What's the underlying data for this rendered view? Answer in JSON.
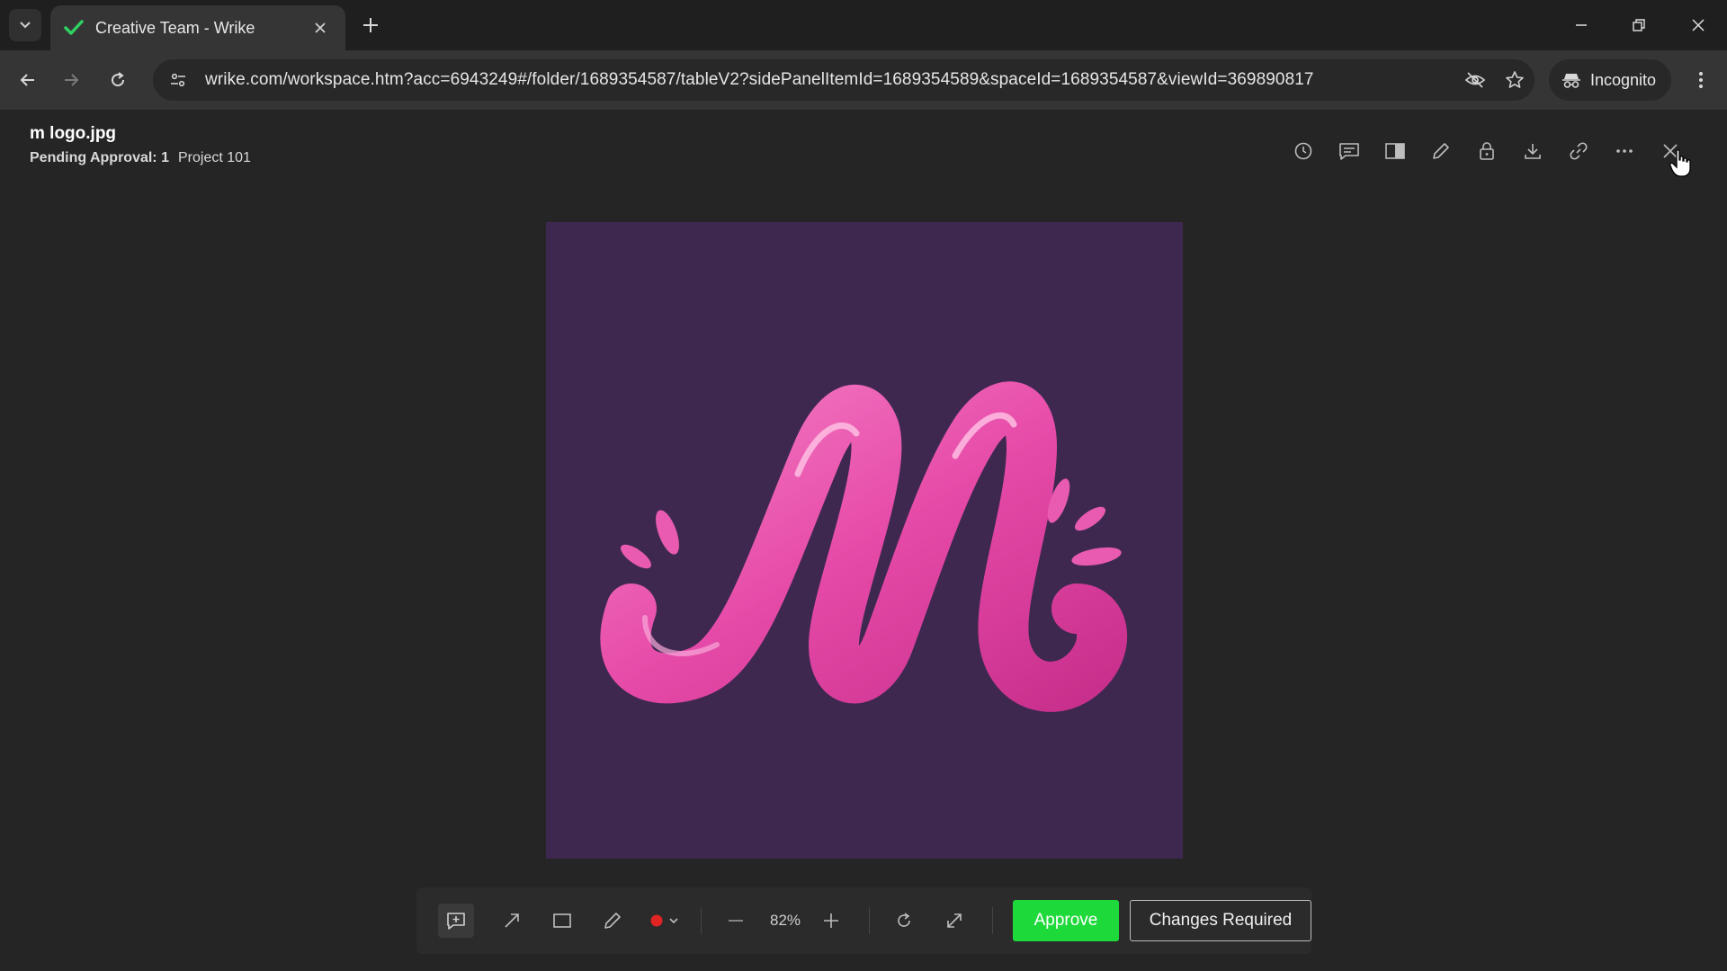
{
  "browser": {
    "tab_title": "Creative Team - Wrike",
    "url": "wrike.com/workspace.htm?acc=6943249#/folder/1689354587/tableV2?sidePanelItemId=1689354589&spaceId=1689354587&viewId=369890817",
    "incognito_label": "Incognito"
  },
  "viewer": {
    "file_name": "m logo.jpg",
    "pending_label": "Pending Approval: 1",
    "project_label": "Project 101",
    "image_bg_color": "#3f2850",
    "logo_color": "#e64aa8",
    "tools": [
      "history-icon",
      "comments-icon",
      "compare-icon",
      "edit-icon",
      "lock-icon",
      "download-icon",
      "link-icon",
      "more-icon",
      "close-icon"
    ]
  },
  "bottom_bar": {
    "zoom": "82%",
    "approve_label": "Approve",
    "changes_label": "Changes Required",
    "annotation_color": "#e02424"
  }
}
